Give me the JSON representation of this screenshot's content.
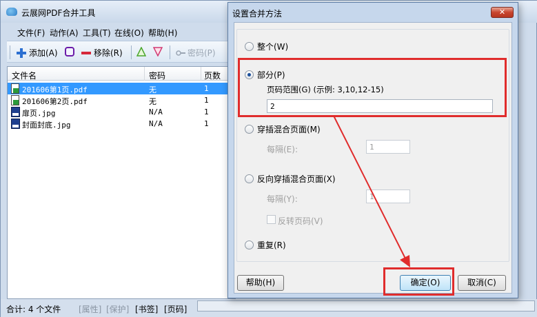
{
  "app": {
    "title": "云展网PDF合并工具",
    "menu": [
      "文件(F)",
      "动作(A)",
      "工具(T)",
      "在线(O)",
      "帮助(H)"
    ],
    "toolbar": {
      "add": "添加(A)",
      "remove": "移除(R)",
      "password": "密码(P)"
    },
    "list": {
      "headers": [
        "文件名",
        "密码",
        "页数"
      ],
      "rows": [
        {
          "name": "201606第1页.pdf",
          "password": "无",
          "pages": "1",
          "selected": true,
          "icon": "pdf-icon"
        },
        {
          "name": "201606第2页.pdf",
          "password": "无",
          "pages": "1",
          "selected": false,
          "icon": "pdf-icon"
        },
        {
          "name": "扉页.jpg",
          "password": "N/A",
          "pages": "1",
          "selected": false,
          "icon": "image-icon"
        },
        {
          "name": "封面封底.jpg",
          "password": "N/A",
          "pages": "1",
          "selected": false,
          "icon": "image-icon"
        }
      ]
    },
    "status": {
      "total": "合计: 4 个文件",
      "props": "[属性]",
      "protect": "[保护]",
      "bookmark": "[书签]",
      "pagecode": "[页码]"
    }
  },
  "dialog": {
    "title": "设置合并方法",
    "close": "✕",
    "options": {
      "whole": "整个(W)",
      "part": "部分(P)",
      "page_range_label": "页码范围(G) (示例: 3,10,12-15)",
      "page_range_value": "2",
      "interleave": "穿插混合页面(M)",
      "interleave_every_label": "每隔(E):",
      "interleave_every_value": "1",
      "reverse_interleave": "反向穿插混合页面(X)",
      "reverse_every_label": "每隔(Y):",
      "reverse_every_value": "1",
      "reverse_pages": "反转页码(V)",
      "repeat": "重复(R)"
    },
    "buttons": {
      "help": "帮助(H)",
      "ok": "确定(O)",
      "cancel": "取消(C)"
    },
    "selected_option": "part"
  },
  "colors": {
    "highlight": "#e02c2c",
    "selection": "#3399ff"
  }
}
